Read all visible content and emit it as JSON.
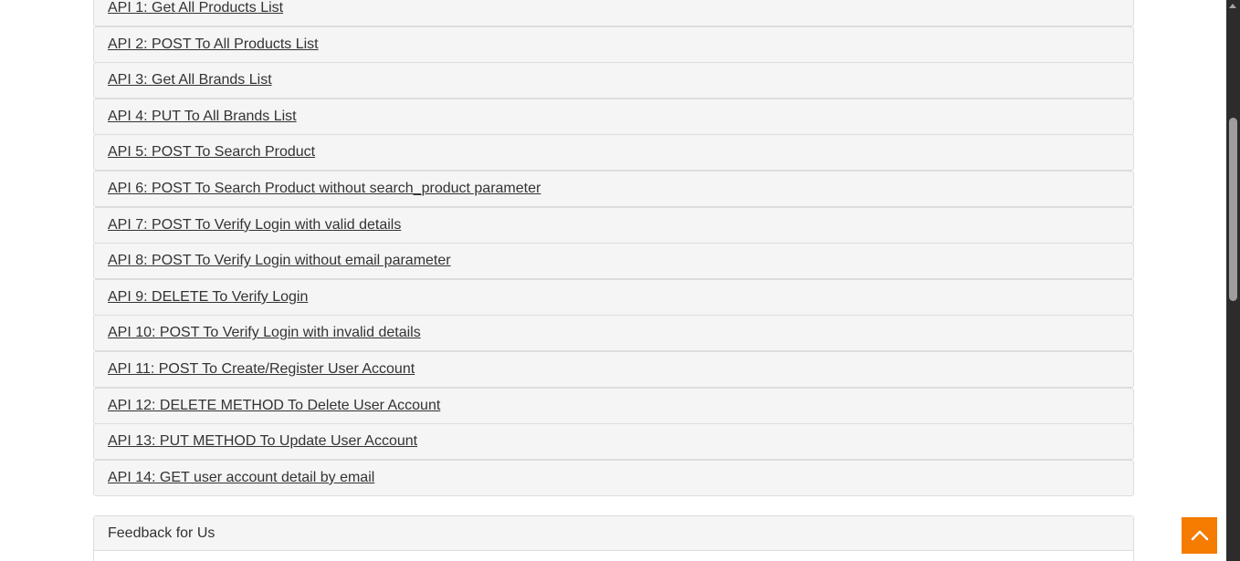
{
  "api_list": {
    "items": [
      {
        "label": "API 1: Get All Products List"
      },
      {
        "label": "API 2: POST To All Products List"
      },
      {
        "label": "API 3: Get All Brands List"
      },
      {
        "label": "API 4: PUT To All Brands List"
      },
      {
        "label": "API 5: POST To Search Product"
      },
      {
        "label": "API 6: POST To Search Product without search_product parameter"
      },
      {
        "label": "API 7: POST To Verify Login with valid details"
      },
      {
        "label": "API 8: POST To Verify Login without email parameter"
      },
      {
        "label": "API 9: DELETE To Verify Login"
      },
      {
        "label": "API 10: POST To Verify Login with invalid details"
      },
      {
        "label": "API 11: POST To Create/Register User Account"
      },
      {
        "label": "API 12: DELETE METHOD To Delete User Account"
      },
      {
        "label": "API 13: PUT METHOD To Update User Account"
      },
      {
        "label": "API 14: GET user account detail by email"
      }
    ]
  },
  "feedback": {
    "heading": "Feedback for Us"
  },
  "colors": {
    "accent": "#f57c00",
    "panel_bg": "#f5f5f5",
    "border": "#dddddd",
    "text": "#333333"
  },
  "icons": {
    "scroll_up": "chevron-up-icon"
  }
}
